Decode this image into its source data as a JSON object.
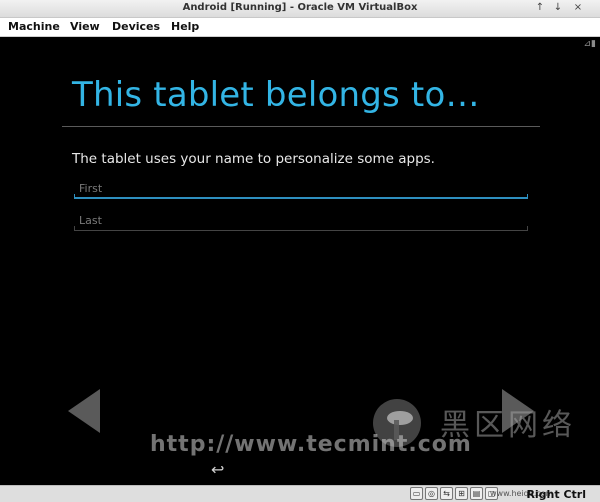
{
  "window": {
    "title": "Android [Running] - Oracle VM VirtualBox",
    "controls": [
      "↑",
      "↓",
      "×"
    ]
  },
  "menu": {
    "items": [
      "Machine",
      "View",
      "Devices",
      "Help"
    ]
  },
  "android": {
    "heading": "This tablet belongs to…",
    "description": "The tablet uses your name to personalize some apps.",
    "first_placeholder": "First",
    "last_placeholder": "Last",
    "back_glyph": "↩",
    "status_glyph": "⊿▮"
  },
  "watermark": {
    "url": "http://www.tecmint.com",
    "chinese": "黑区网络",
    "site": "www.heiqu.com"
  },
  "statusbar": {
    "host_key": "Right Ctrl",
    "icons": [
      "disk-icon",
      "optical-icon",
      "usb-icon",
      "network-icon",
      "shared-folder-icon",
      "display-icon",
      "capture-icon",
      "mouse-icon"
    ]
  }
}
